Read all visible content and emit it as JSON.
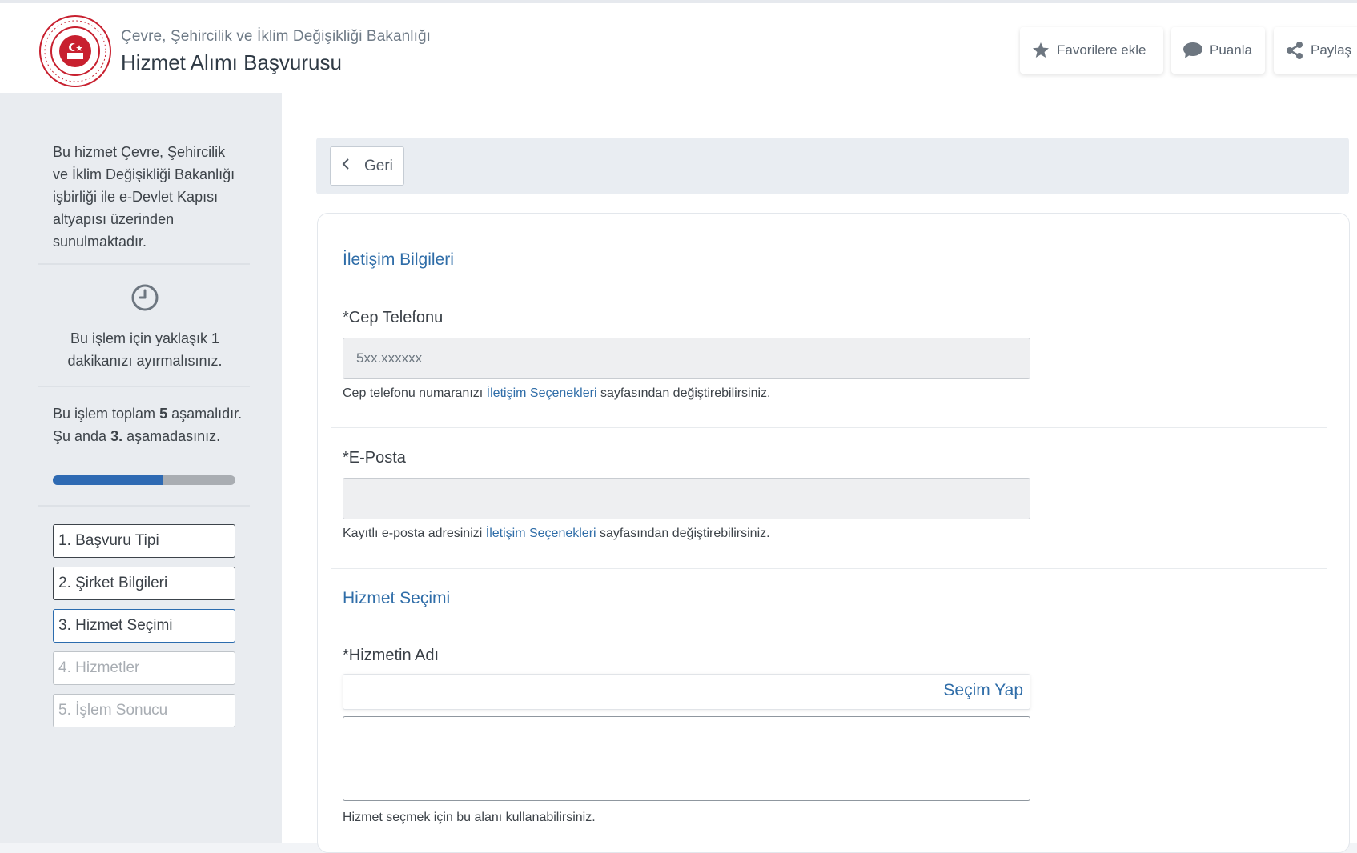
{
  "header": {
    "institution": "Çevre, Şehircilik ve İklim Değişikliği Bakanlığı",
    "service_title": "Hizmet Alımı Başvurusu",
    "actions": {
      "favorite": "Favorilere ekle",
      "rate": "Puanla",
      "share": "Paylaş"
    }
  },
  "sidebar": {
    "info": "Bu hizmet Çevre, Şehircilik ve İklim Değişikliği Bakanlığı işbirliği ile e-Devlet Kapısı altyapısı üzerinden sunulmaktadır.",
    "time_note": "Bu işlem için yaklaşık 1 dakikanızı ayırmalısınız.",
    "steps_prefix": "Bu işlem toplam ",
    "steps_total": "5",
    "steps_middle": " aşamalıdır. Şu anda ",
    "steps_current": "3.",
    "steps_suffix": " aşamadasınız.",
    "progress": 0.6,
    "steps": [
      {
        "label": "1. Başvuru Tipi",
        "state": "done"
      },
      {
        "label": "2. Şirket Bilgileri",
        "state": "done"
      },
      {
        "label": "3. Hizmet Seçimi",
        "state": "active"
      },
      {
        "label": "4. Hizmetler",
        "state": "disabled"
      },
      {
        "label": "5. İşlem Sonucu",
        "state": "disabled"
      }
    ]
  },
  "main": {
    "back_label": "Geri",
    "contact_title": "İletişim Bilgileri",
    "phone_label": "*Cep Telefonu",
    "phone_value": "5xx.xxxxxx",
    "phone_help_before": "Cep telefonu numaranızı ",
    "phone_help_link": "İletişim Seçenekleri",
    "phone_help_after": " sayfasından değiştirebilirsiniz.",
    "email_label": "*E-Posta",
    "email_value": "",
    "email_help_before": "Kayıtlı e-posta adresinizi ",
    "email_help_link": "İletişim Seçenekleri",
    "email_help_after": " sayfasından değiştirebilirsiniz.",
    "service_section_title": "Hizmet Seçimi",
    "service_name_label": "*Hizmetin Adı",
    "select_label": "Seçim Yap",
    "service_help": "Hizmet seçmek için bu alanı kullanabilirsiniz."
  },
  "colors": {
    "accent": "#2f6da8",
    "progress_fill": "#2e6ab3",
    "logo_red": "#c8202f"
  },
  "icons": {
    "favorite": "star-icon",
    "rate": "speech-bubble-icon",
    "share": "share-icon",
    "time": "clock-icon",
    "back": "chevron-left-icon"
  }
}
